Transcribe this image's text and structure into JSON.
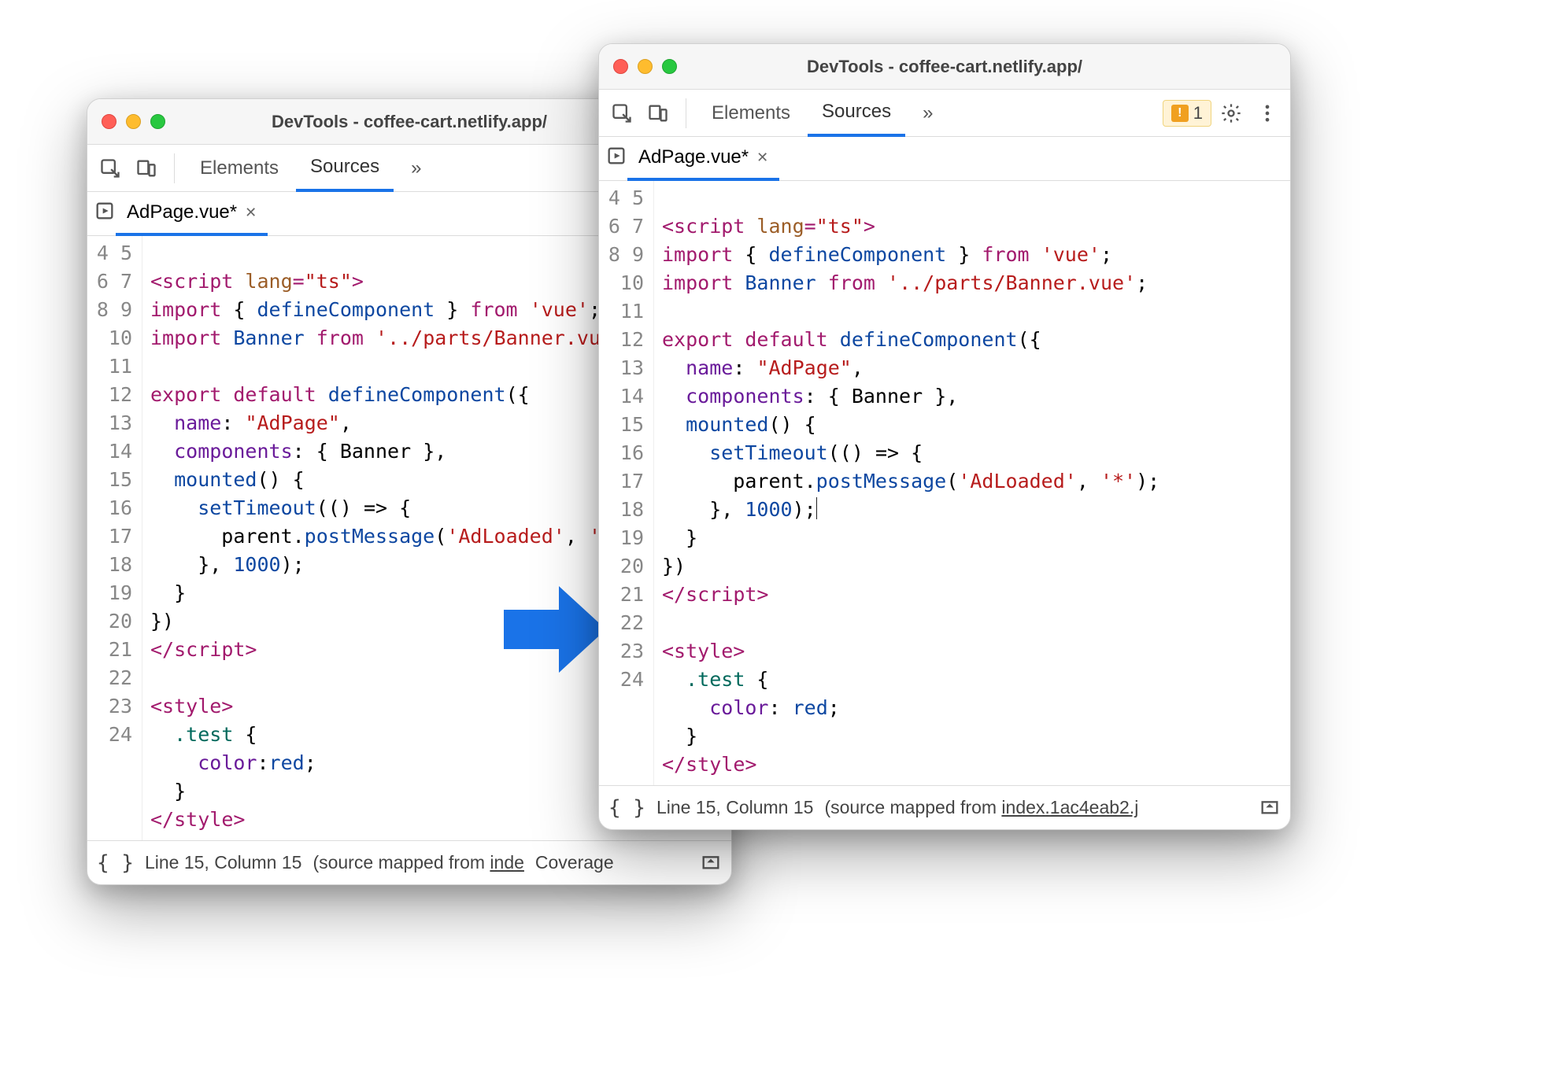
{
  "window_title": "DevTools - coffee-cart.netlify.app/",
  "tabs": {
    "elements": "Elements",
    "sources": "Sources",
    "more": "»"
  },
  "issues": {
    "count": "1"
  },
  "file": {
    "name": "AdPage.vue*"
  },
  "status": {
    "line_col": "Line 15, Column 15",
    "mapped_prefix": "(source mapped from ",
    "left_link": "inde",
    "right_link": "index.1ac4eab2.j",
    "coverage": "Coverage"
  },
  "code_left": {
    "start": 4,
    "lines": [
      "",
      [
        [
          "tag",
          "<script "
        ],
        [
          "attr",
          "lang"
        ],
        [
          "tag",
          "="
        ],
        [
          "str",
          "\"ts\""
        ],
        [
          "tag",
          ">"
        ]
      ],
      [
        [
          "kw",
          "import"
        ],
        [
          "",
          " { "
        ],
        [
          "id",
          "defineComponent"
        ],
        [
          "",
          " } "
        ],
        [
          "kw",
          "from"
        ],
        [
          "",
          " "
        ],
        [
          "str",
          "'vue'"
        ],
        [
          "",
          ";"
        ]
      ],
      [
        [
          "kw",
          "import"
        ],
        [
          "",
          " "
        ],
        [
          "id",
          "Banner"
        ],
        [
          "",
          " "
        ],
        [
          "kw",
          "from"
        ],
        [
          "",
          " "
        ],
        [
          "str",
          "'../parts/Banner.vue"
        ]
      ],
      "",
      [
        [
          "kw",
          "export"
        ],
        [
          "",
          " "
        ],
        [
          "kw",
          "default"
        ],
        [
          "",
          " "
        ],
        [
          "id",
          "defineComponent"
        ],
        [
          "",
          "({"
        ]
      ],
      [
        [
          "",
          "  "
        ],
        [
          "prop",
          "name"
        ],
        [
          "",
          ": "
        ],
        [
          "str",
          "\"AdPage\""
        ],
        [
          "",
          ","
        ]
      ],
      [
        [
          "",
          "  "
        ],
        [
          "prop",
          "components"
        ],
        [
          "",
          ": { Banner },"
        ]
      ],
      [
        [
          "",
          "  "
        ],
        [
          "id",
          "mounted"
        ],
        [
          "",
          "() {"
        ]
      ],
      [
        [
          "",
          "    "
        ],
        [
          "id",
          "setTimeout"
        ],
        [
          "",
          "(() => {"
        ]
      ],
      [
        [
          "",
          "      parent."
        ],
        [
          "id",
          "postMessage"
        ],
        [
          "",
          "("
        ],
        [
          "str",
          "'AdLoaded'"
        ],
        [
          "",
          ", "
        ],
        [
          "str",
          "'*"
        ]
      ],
      [
        [
          "",
          "    }, "
        ],
        [
          "num",
          "1000"
        ],
        [
          "",
          ");"
        ]
      ],
      [
        [
          "",
          "  }"
        ]
      ],
      [
        [
          "",
          "})"
        ]
      ],
      [
        [
          "slash",
          "</"
        ],
        [
          "tag",
          "script"
        ],
        [
          "tag",
          ">"
        ]
      ],
      "",
      [
        [
          "tag",
          "<style>"
        ]
      ],
      [
        [
          "",
          "  "
        ],
        [
          "sel",
          ".test"
        ],
        [
          "",
          " {"
        ]
      ],
      [
        [
          "",
          "    "
        ],
        [
          "prop",
          "color"
        ],
        [
          "",
          ":"
        ],
        [
          "id",
          "red"
        ],
        [
          "",
          ";"
        ]
      ],
      [
        [
          "",
          "  }"
        ]
      ],
      [
        [
          "slash",
          "</"
        ],
        [
          "tag",
          "style"
        ],
        [
          "tag",
          ">"
        ]
      ]
    ]
  },
  "code_right": {
    "start": 4,
    "lines": [
      "",
      [
        [
          "tag",
          "<script "
        ],
        [
          "attr",
          "lang"
        ],
        [
          "tag",
          "="
        ],
        [
          "str",
          "\"ts\""
        ],
        [
          "tag",
          ">"
        ]
      ],
      [
        [
          "kw",
          "import"
        ],
        [
          "",
          " { "
        ],
        [
          "id",
          "defineComponent"
        ],
        [
          "",
          " } "
        ],
        [
          "kw",
          "from"
        ],
        [
          "",
          " "
        ],
        [
          "str",
          "'vue'"
        ],
        [
          "",
          ";"
        ]
      ],
      [
        [
          "kw",
          "import"
        ],
        [
          "",
          " "
        ],
        [
          "id",
          "Banner"
        ],
        [
          "",
          " "
        ],
        [
          "kw",
          "from"
        ],
        [
          "",
          " "
        ],
        [
          "str",
          "'../parts/Banner.vue'"
        ],
        [
          "",
          ";"
        ]
      ],
      "",
      [
        [
          "kw",
          "export"
        ],
        [
          "",
          " "
        ],
        [
          "kw",
          "default"
        ],
        [
          "",
          " "
        ],
        [
          "id",
          "defineComponent"
        ],
        [
          "",
          "({"
        ]
      ],
      [
        [
          "",
          "  "
        ],
        [
          "prop",
          "name"
        ],
        [
          "",
          ": "
        ],
        [
          "str",
          "\"AdPage\""
        ],
        [
          "",
          ","
        ]
      ],
      [
        [
          "",
          "  "
        ],
        [
          "prop",
          "components"
        ],
        [
          "",
          ": { Banner },"
        ]
      ],
      [
        [
          "",
          "  "
        ],
        [
          "id",
          "mounted"
        ],
        [
          "",
          "() {"
        ]
      ],
      [
        [
          "",
          "    "
        ],
        [
          "id",
          "setTimeout"
        ],
        [
          "",
          "(() => {"
        ]
      ],
      [
        [
          "",
          "      parent."
        ],
        [
          "id",
          "postMessage"
        ],
        [
          "",
          "("
        ],
        [
          "str",
          "'AdLoaded'"
        ],
        [
          "",
          ", "
        ],
        [
          "str",
          "'*'"
        ],
        [
          "",
          ");"
        ]
      ],
      [
        [
          "",
          "    }, "
        ],
        [
          "num",
          "1000"
        ],
        [
          "",
          ");"
        ],
        [
          "cursor",
          ""
        ]
      ],
      [
        [
          "",
          "  }"
        ]
      ],
      [
        [
          "",
          "})"
        ]
      ],
      [
        [
          "slash",
          "</"
        ],
        [
          "tag",
          "script"
        ],
        [
          "tag",
          ">"
        ]
      ],
      "",
      [
        [
          "tag",
          "<style>"
        ]
      ],
      [
        [
          "",
          "  "
        ],
        [
          "sel",
          ".test"
        ],
        [
          "",
          " {"
        ]
      ],
      [
        [
          "",
          "    "
        ],
        [
          "prop",
          "color"
        ],
        [
          "",
          ": "
        ],
        [
          "id",
          "red"
        ],
        [
          "",
          ";"
        ]
      ],
      [
        [
          "",
          "  }"
        ]
      ],
      [
        [
          "slash",
          "</"
        ],
        [
          "tag",
          "style"
        ],
        [
          "tag",
          ">"
        ]
      ]
    ]
  }
}
